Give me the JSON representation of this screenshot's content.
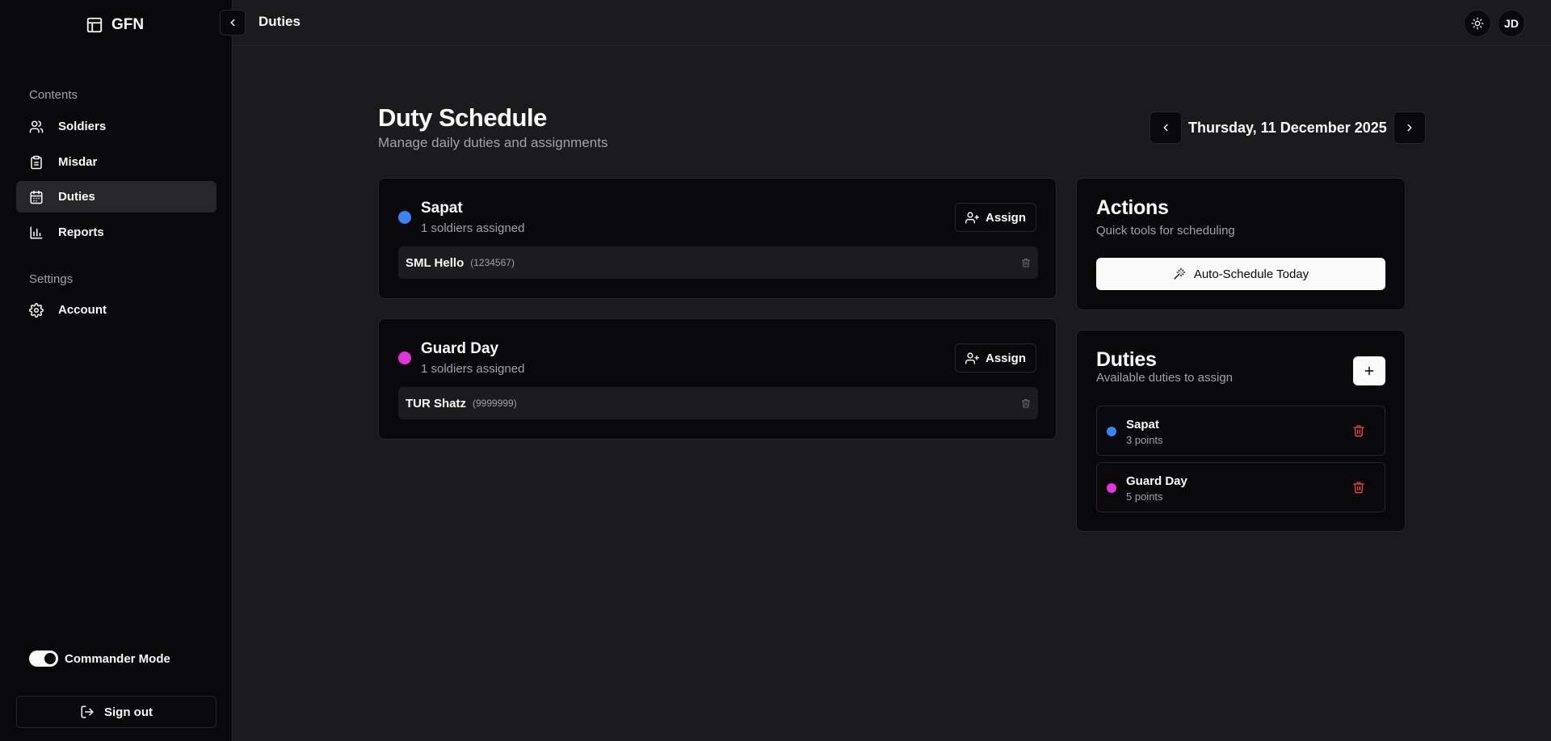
{
  "app": {
    "brand": "GFN",
    "page_title": "Duties"
  },
  "sidebar": {
    "contents_label": "Contents",
    "items": [
      {
        "label": "Soldiers",
        "icon": "users-icon"
      },
      {
        "label": "Misdar",
        "icon": "clipboard-icon"
      },
      {
        "label": "Duties",
        "icon": "calendar-icon",
        "active": true
      },
      {
        "label": "Reports",
        "icon": "bar-chart-icon"
      }
    ],
    "settings_label": "Settings",
    "settings_items": [
      {
        "label": "Account",
        "icon": "gear-icon"
      }
    ],
    "commander_mode_label": "Commander Mode",
    "commander_mode_on": true,
    "sign_out_label": "Sign out"
  },
  "header": {
    "title": "Duties",
    "avatar_initials": "JD"
  },
  "main": {
    "title": "Duty Schedule",
    "subtitle": "Manage daily duties and assignments",
    "date": "Thursday, 11 December 2025",
    "duty_cards": [
      {
        "name": "Sapat",
        "color": "#3b82f6",
        "count_text": "1 soldiers assigned",
        "assign_label": "Assign",
        "soldiers": [
          {
            "name": "SML Hello",
            "id": "(1234567)"
          }
        ]
      },
      {
        "name": "Guard Day",
        "color": "#e535d7",
        "count_text": "1 soldiers assigned",
        "assign_label": "Assign",
        "soldiers": [
          {
            "name": "TUR Shatz",
            "id": "(9999999)"
          }
        ]
      }
    ]
  },
  "actions": {
    "title": "Actions",
    "subtitle": "Quick tools for scheduling",
    "auto_schedule_label": "Auto-Schedule Today"
  },
  "duties_panel": {
    "title": "Duties",
    "subtitle": "Available duties to assign",
    "items": [
      {
        "name": "Sapat",
        "points": "3 points",
        "color": "#3b82f6"
      },
      {
        "name": "Guard Day",
        "points": "5 points",
        "color": "#e535d7"
      }
    ]
  },
  "colors": {
    "accent_red": "#ef4444",
    "background": "#1b1b1d",
    "card": "#09090b",
    "border": "#27272a"
  }
}
